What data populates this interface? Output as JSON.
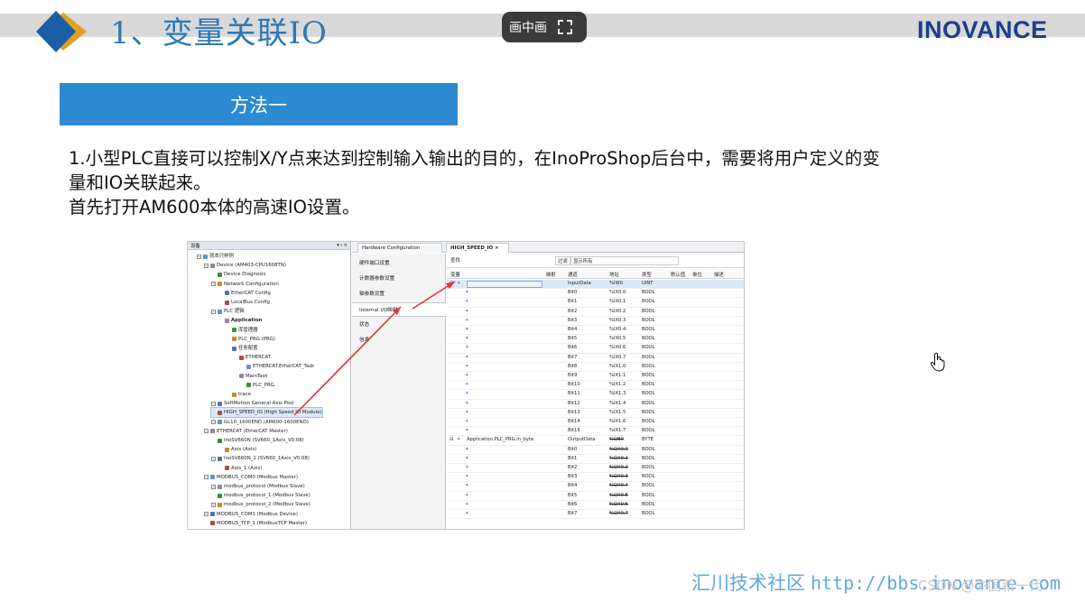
{
  "slide": {
    "title": "1、变量关联IO",
    "brand": "INOVANCE",
    "method_label": "方法一",
    "paragraph_lines": [
      "1.小型PLC直接可以控制X/Y点来达到控制输入输出的目的，在InoProShop后台中，需要将用户定义的变",
      "量和IO关联起来。",
      "首先打开AM600本体的高速IO设置。"
    ],
    "footer_label": "汇川技术社区",
    "footer_url": "http://bbs.inovance.com",
    "watermark": "CSDN @牛国新一代",
    "pip_label": "画中画"
  },
  "colors": {
    "title_blue": "#2e78b7",
    "method_box": "#2e8ad0",
    "brand_navy": "#1a3f8c",
    "footer_blue": "#5fa9de",
    "arrow_red": "#e53030"
  },
  "screenshot": {
    "tree_header": "设备",
    "tree": [
      {
        "label": "就本只样例",
        "indent": 1,
        "icon": "project-icon"
      },
      {
        "label": "Device (AM403-CPU1608TN)",
        "indent": 2,
        "icon": "device-icon"
      },
      {
        "label": "Device Diagnosis",
        "indent": 3,
        "icon": "diagnosis-icon"
      },
      {
        "label": "Network Configuration",
        "indent": 3,
        "icon": "network-icon"
      },
      {
        "label": "EtherCAT Config",
        "indent": 4,
        "icon": "ethercat-icon"
      },
      {
        "label": "LocalBus Config",
        "indent": 4,
        "icon": "localbus-icon"
      },
      {
        "label": "PLC 逻辑",
        "indent": 3,
        "icon": "plc-logic-icon"
      },
      {
        "label": "Application",
        "indent": 4,
        "icon": "application-icon",
        "bold": true
      },
      {
        "label": "库管理器",
        "indent": 5,
        "icon": "library-icon"
      },
      {
        "label": "PLC_PRG (PRG)",
        "indent": 5,
        "icon": "program-icon"
      },
      {
        "label": "任务配置",
        "indent": 5,
        "icon": "task-config-icon"
      },
      {
        "label": "ETHERCAT",
        "indent": 6,
        "icon": "task-icon"
      },
      {
        "label": "ETHERCAT.EtherCAT_Task",
        "indent": 7,
        "icon": "task-item-icon"
      },
      {
        "label": "MainTask",
        "indent": 6,
        "icon": "task-icon"
      },
      {
        "label": "PLC_PRG",
        "indent": 7,
        "icon": "task-item-icon"
      },
      {
        "label": "trace",
        "indent": 5,
        "icon": "trace-icon"
      },
      {
        "label": "SoftMotion General Axis Pool",
        "indent": 3,
        "icon": "axis-pool-icon"
      },
      {
        "label": "HIGH_SPEED_IO (High Speed IO Module)",
        "indent": 3,
        "icon": "io-module-icon",
        "highlight": true
      },
      {
        "label": "GL10_1600END (AM600-1600END)",
        "indent": 3,
        "icon": "io-module-icon"
      },
      {
        "label": "ETHERCAT (EtherCAT Master)",
        "indent": 2,
        "icon": "ethercat-master-icon"
      },
      {
        "label": "InoSV660N (SV660_1Axis_V0.08)",
        "indent": 3,
        "icon": "servo-icon"
      },
      {
        "label": "Axis (Axis)",
        "indent": 4,
        "icon": "axis-icon"
      },
      {
        "label": "InoSV660N_1 (SV660_1Axis_V0.08)",
        "indent": 3,
        "icon": "servo-icon"
      },
      {
        "label": "Axis_1 (Axis)",
        "indent": 4,
        "icon": "axis-icon"
      },
      {
        "label": "MODBUS_COM0 (Modbus Master)",
        "indent": 2,
        "icon": "modbus-icon"
      },
      {
        "label": "modbus_protocol (Modbus Slave)",
        "indent": 3,
        "icon": "modbus-slave-icon"
      },
      {
        "label": "modbus_protocol_1 (Modbus Slave)",
        "indent": 3,
        "icon": "modbus-slave-icon"
      },
      {
        "label": "modbus_protocol_2 (Modbus Slave)",
        "indent": 3,
        "icon": "modbus-slave-icon"
      },
      {
        "label": "MODBUS_COM1 (Modbus Device)",
        "indent": 2,
        "icon": "modbus-icon"
      },
      {
        "label": "MODBUS_TCP_1 (ModbusTCP Master)",
        "indent": 2,
        "icon": "modbus-icon"
      }
    ],
    "tabs": [
      {
        "label": "Hardware Configuration",
        "active": false
      },
      {
        "label": "HIGH_SPEED_IO",
        "active": true
      }
    ],
    "config_nav": [
      {
        "label": "硬件端口设置",
        "active": false
      },
      {
        "label": "计数器参数设置",
        "active": false
      },
      {
        "label": "轴参数设置",
        "active": false
      },
      {
        "label": "Internal I/O映射",
        "active": true
      },
      {
        "label": "状态",
        "active": false
      },
      {
        "label": "信息",
        "active": false
      }
    ],
    "filter": {
      "find_label": "查找",
      "filter_label": "过滤",
      "filter_value": "显示所有"
    },
    "columns": [
      "变量",
      "映射",
      "通道",
      "地址",
      "类型",
      "默认值",
      "单位",
      "描述"
    ],
    "rows": [
      {
        "var": "",
        "channel": "InputData",
        "address": "%IW0",
        "type": "UINT",
        "parent": true,
        "selected": true
      },
      {
        "var": "",
        "channel": "Bit0",
        "address": "%IX0.0",
        "type": "BOOL"
      },
      {
        "var": "",
        "channel": "Bit1",
        "address": "%IX0.1",
        "type": "BOOL"
      },
      {
        "var": "",
        "channel": "Bit2",
        "address": "%IX0.2",
        "type": "BOOL"
      },
      {
        "var": "",
        "channel": "Bit3",
        "address": "%IX0.3",
        "type": "BOOL"
      },
      {
        "var": "",
        "channel": "Bit4",
        "address": "%IX0.4",
        "type": "BOOL"
      },
      {
        "var": "",
        "channel": "Bit5",
        "address": "%IX0.5",
        "type": "BOOL"
      },
      {
        "var": "",
        "channel": "Bit6",
        "address": "%IX0.6",
        "type": "BOOL"
      },
      {
        "var": "",
        "channel": "Bit7",
        "address": "%IX0.7",
        "type": "BOOL"
      },
      {
        "var": "",
        "channel": "Bit8",
        "address": "%IX1.0",
        "type": "BOOL"
      },
      {
        "var": "",
        "channel": "Bit9",
        "address": "%IX1.1",
        "type": "BOOL"
      },
      {
        "var": "",
        "channel": "Bit10",
        "address": "%IX1.2",
        "type": "BOOL"
      },
      {
        "var": "",
        "channel": "Bit11",
        "address": "%IX1.3",
        "type": "BOOL"
      },
      {
        "var": "",
        "channel": "Bit12",
        "address": "%IX1.4",
        "type": "BOOL"
      },
      {
        "var": "",
        "channel": "Bit13",
        "address": "%IX1.5",
        "type": "BOOL"
      },
      {
        "var": "",
        "channel": "Bit14",
        "address": "%IX1.6",
        "type": "BOOL"
      },
      {
        "var": "",
        "channel": "Bit15",
        "address": "%IX1.7",
        "type": "BOOL"
      },
      {
        "var": "Application.PLC_PRG.in_byte",
        "channel": "OutputData",
        "address": "%QB0",
        "type": "BYTE",
        "parent": true,
        "strike": true
      },
      {
        "var": "",
        "channel": "Bit0",
        "address": "%QX0.0",
        "type": "BOOL",
        "strike": true
      },
      {
        "var": "",
        "channel": "Bit1",
        "address": "%QX0.1",
        "type": "BOOL",
        "strike": true
      },
      {
        "var": "",
        "channel": "Bit2",
        "address": "%QX0.2",
        "type": "BOOL",
        "strike": true
      },
      {
        "var": "",
        "channel": "Bit3",
        "address": "%QX0.3",
        "type": "BOOL",
        "strike": true
      },
      {
        "var": "",
        "channel": "Bit4",
        "address": "%QX0.4",
        "type": "BOOL",
        "strike": true
      },
      {
        "var": "",
        "channel": "Bit5",
        "address": "%QX0.5",
        "type": "BOOL",
        "strike": true
      },
      {
        "var": "",
        "channel": "Bit6",
        "address": "%QX0.6",
        "type": "BOOL",
        "strike": true
      },
      {
        "var": "",
        "channel": "Bit7",
        "address": "%QX0.7",
        "type": "BOOL",
        "strike": true
      }
    ]
  }
}
